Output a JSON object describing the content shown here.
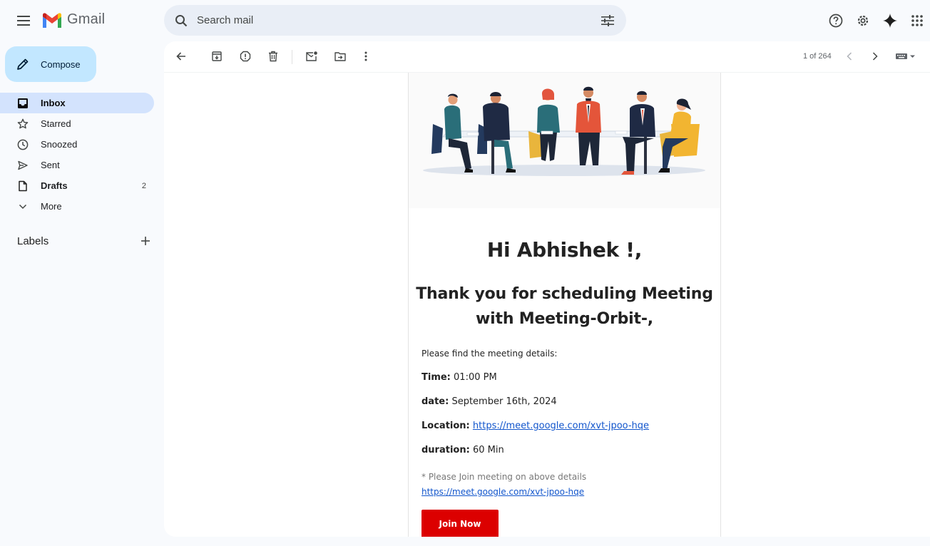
{
  "app": {
    "name": "Gmail"
  },
  "search": {
    "placeholder": "Search mail"
  },
  "sidebar": {
    "compose_label": "Compose",
    "items": [
      {
        "label": "Inbox",
        "count": ""
      },
      {
        "label": "Starred",
        "count": ""
      },
      {
        "label": "Snoozed",
        "count": ""
      },
      {
        "label": "Sent",
        "count": ""
      },
      {
        "label": "Drafts",
        "count": "2"
      },
      {
        "label": "More",
        "count": ""
      }
    ],
    "labels_title": "Labels"
  },
  "toolbar": {
    "page_count": "1 of 264"
  },
  "email": {
    "greeting": "Hi Abhishek !,",
    "thanks_line1": "Thank you for scheduling Meeting",
    "thanks_line2": "with Meeting-Orbit-,",
    "intro": "Please find the meeting details:",
    "time_label": "Time:",
    "time_value": "01:00 PM",
    "date_label": "date:",
    "date_value": "September 16th, 2024",
    "location_label": "Location:",
    "location_link": "https://meet.google.com/xvt-jpoo-hqe",
    "duration_label": "duration:",
    "duration_value": "60 Min",
    "note_text": "* Please Join meeting on above details ",
    "note_link": "https://meet.google.com/xvt-jpoo-hqe",
    "join_label": "Join Now"
  },
  "colors": {
    "compose_bg": "#c2e7ff",
    "active_nav": "#d3e3fd",
    "search_bg": "#e9eef6",
    "join_button": "#dc0000",
    "link": "#1155cc"
  }
}
